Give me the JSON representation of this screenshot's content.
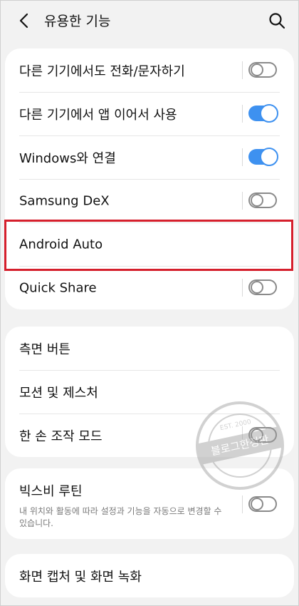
{
  "header": {
    "title": "유용한 기능",
    "back_icon": "chevron-left-icon",
    "search_icon": "search-icon"
  },
  "section1": [
    {
      "label": "다른 기기에서도 전화/문자하기",
      "toggle": "off"
    },
    {
      "label": "다른 기기에서 앱 이어서 사용",
      "toggle": "on"
    },
    {
      "label": "Windows와 연결",
      "toggle": "on"
    },
    {
      "label": "Samsung DeX",
      "toggle": "off"
    },
    {
      "label": "Android Auto"
    },
    {
      "label": "Quick Share",
      "toggle": "off"
    }
  ],
  "section2": [
    {
      "label": "측면 버튼"
    },
    {
      "label": "모션 및 제스처"
    },
    {
      "label": "한 손 조작 모드",
      "toggle": "off"
    }
  ],
  "section3": {
    "title": "빅스비 루틴",
    "description": "내 위치와 활동에 따라 설정과 기능을 자동으로 변경할 수 있습니다.",
    "toggle": "off"
  },
  "section4": {
    "label": "화면 캡처 및 화면 녹화"
  },
  "watermark": {
    "text_main": "블로그한정판",
    "text_sub": "EST. 2000"
  },
  "colors": {
    "toggle_on": "#3e91f0",
    "highlight_box": "#d51f2c",
    "background": "#f2f2f2"
  }
}
